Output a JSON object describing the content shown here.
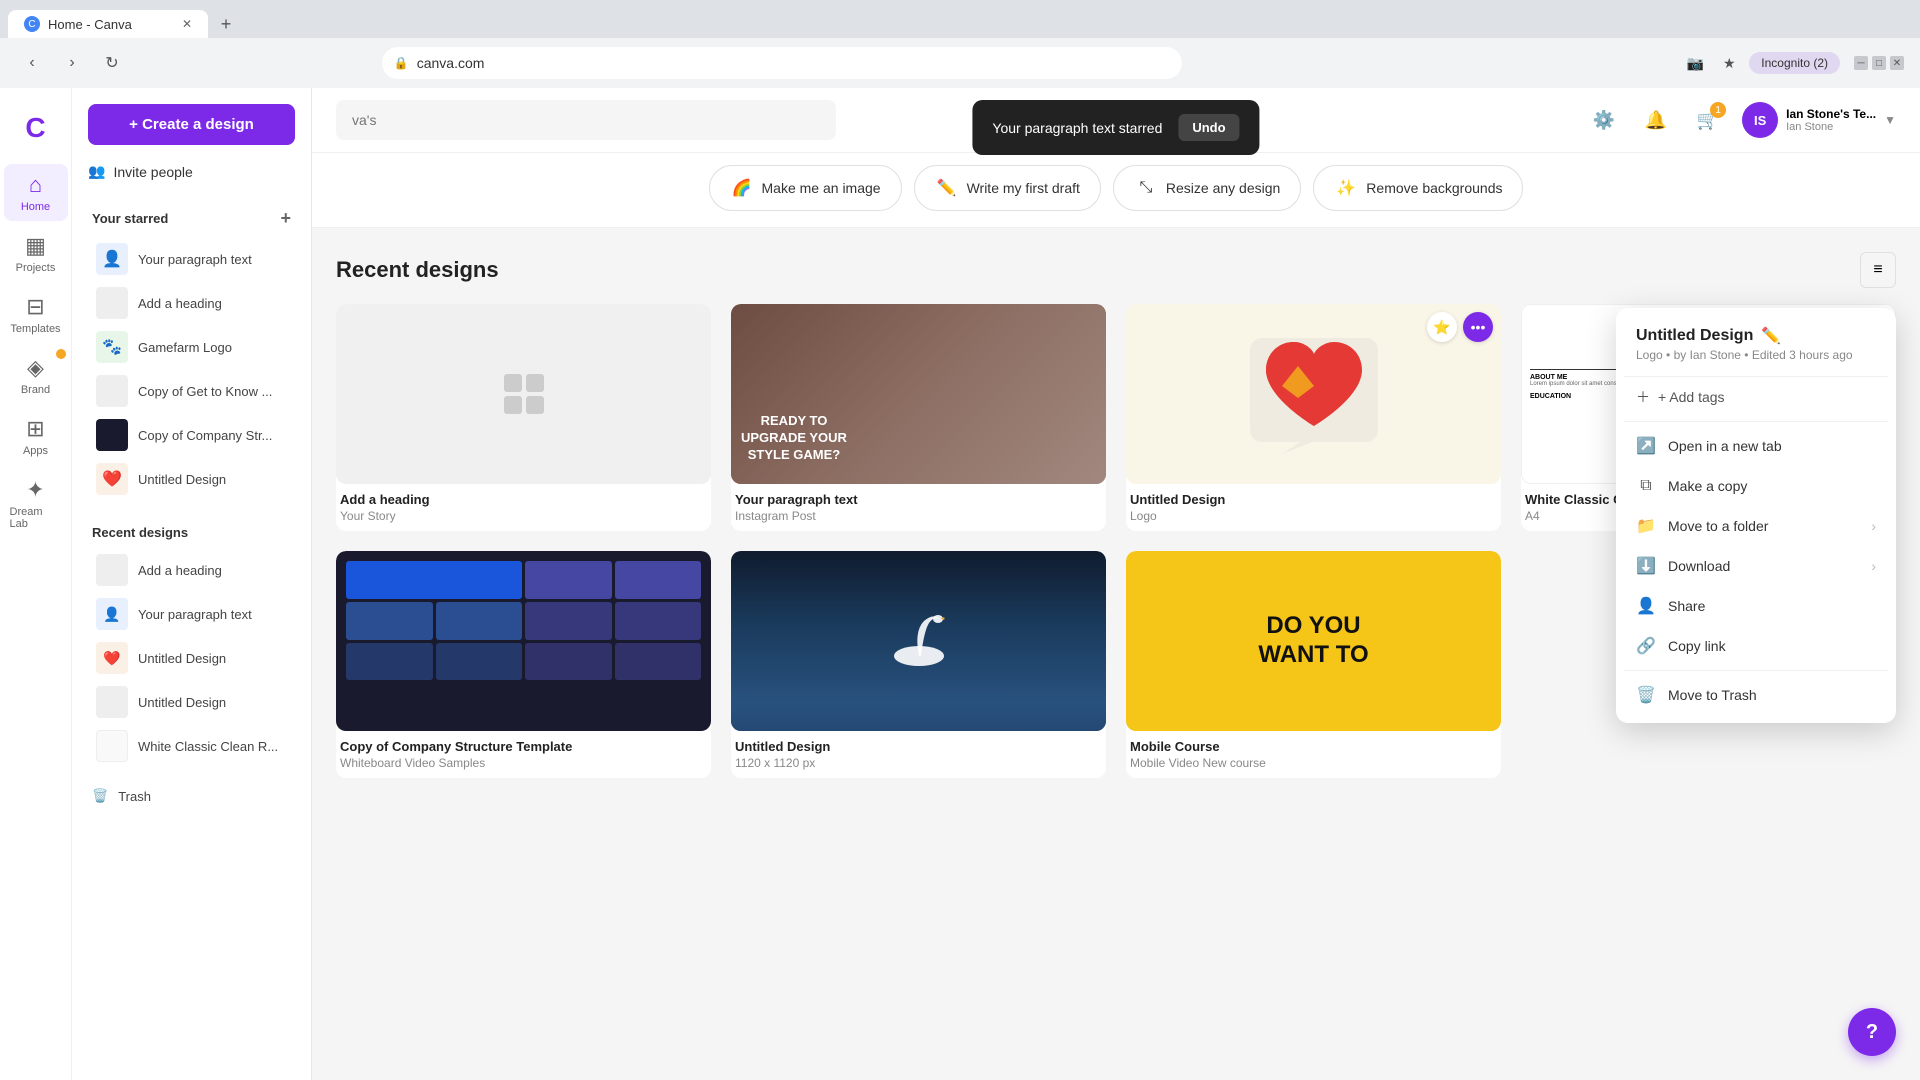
{
  "browser": {
    "tab_title": "Home - Canva",
    "url": "canva.com",
    "new_tab_btn": "+",
    "profile_label": "Incognito (2)"
  },
  "sidebar": {
    "logo": "Canva",
    "create_btn": "+ Create a design",
    "invite_btn": "Invite people",
    "nav_items": [
      {
        "label": "Home",
        "icon": "⌂",
        "active": true
      },
      {
        "label": "Projects",
        "icon": "▦"
      },
      {
        "label": "Templates",
        "icon": "☰"
      },
      {
        "label": "Brand",
        "icon": "◈"
      },
      {
        "label": "Apps",
        "icon": "⊞"
      },
      {
        "label": "Dream Lab",
        "icon": "✦"
      }
    ],
    "starred_section": "Your starred",
    "starred_add": "+",
    "starred_items": [
      {
        "name": "Your paragraph text",
        "thumb_type": "para"
      },
      {
        "name": "Add a heading",
        "thumb_type": "blank"
      },
      {
        "name": "Gamefarm Logo",
        "thumb_type": "game"
      },
      {
        "name": "Copy of Get to Know ...",
        "thumb_type": "blank"
      },
      {
        "name": "Copy of Company Str...",
        "thumb_type": "blank"
      },
      {
        "name": "Untitled Design",
        "thumb_type": "heart"
      }
    ],
    "recent_section": "Recent designs",
    "recent_items": [
      {
        "name": "Add a heading",
        "thumb_type": "blank"
      },
      {
        "name": "Your paragraph text",
        "thumb_type": "para"
      },
      {
        "name": "Untitled Design",
        "thumb_type": "heart"
      },
      {
        "name": "Untitled Design",
        "thumb_type": "blank"
      },
      {
        "name": "White Classic Clean R...",
        "thumb_type": "blank"
      }
    ],
    "trash_label": "Trash",
    "trash_icon": "🗑"
  },
  "topbar": {
    "search_placeholder": "va's",
    "settings_icon": "⚙",
    "notifications_icon": "🔔",
    "cart_icon": "🛒",
    "cart_badge": "1",
    "user_name": "Ian Stone's Te...",
    "user_sub": "Ian Stone",
    "user_initials": "IS"
  },
  "toast": {
    "message": "Your paragraph text starred",
    "undo_label": "Undo"
  },
  "feature_strip": {
    "buttons": [
      {
        "label": "Make me an image",
        "icon": "🌈"
      },
      {
        "label": "Write my first draft",
        "icon": "✏️"
      },
      {
        "label": "Resize any design",
        "icon": "⤡"
      },
      {
        "label": "Remove backgrounds",
        "icon": "✨"
      }
    ]
  },
  "main": {
    "section_title": "Recent designs",
    "designs": [
      {
        "name": "Add a heading",
        "type": "Your Story",
        "thumb": "placeholder"
      },
      {
        "name": "Your paragraph text",
        "type": "Instagram Post",
        "thumb": "fashion"
      },
      {
        "name": "Untitled Design",
        "type": "Logo",
        "thumb": "heart",
        "has_star": true,
        "has_more": true
      },
      {
        "name": "White Classic Clean Resume",
        "type": "A4",
        "thumb": "resume"
      },
      {
        "name": "Copy of Company Structure Template",
        "type": "Whiteboard  Video Samples",
        "thumb": "company"
      },
      {
        "name": "Untitled Design",
        "type": "1120 x 1120 px",
        "thumb": "swan"
      },
      {
        "name": "Mobile Course",
        "type": "Mobile Video  New course",
        "thumb": "yellow"
      }
    ]
  },
  "context_menu": {
    "title": "Untitled Design",
    "subtitle": "Logo • by Ian Stone • Edited 3 hours ago",
    "edit_icon": "✏",
    "add_tags": "+ Add tags",
    "items": [
      {
        "label": "Open in a new tab",
        "icon": "↗",
        "has_arrow": false
      },
      {
        "label": "Make a copy",
        "icon": "⧉",
        "has_arrow": false
      },
      {
        "label": "Move to a folder",
        "icon": "📁",
        "has_arrow": true
      },
      {
        "label": "Download",
        "icon": "⬇",
        "has_arrow": true
      },
      {
        "label": "Share",
        "icon": "👤",
        "has_arrow": false
      },
      {
        "label": "Copy link",
        "icon": "🔗",
        "has_arrow": false
      },
      {
        "label": "Move to Trash",
        "icon": "🗑",
        "has_arrow": false
      }
    ]
  },
  "help": {
    "icon": "?"
  }
}
